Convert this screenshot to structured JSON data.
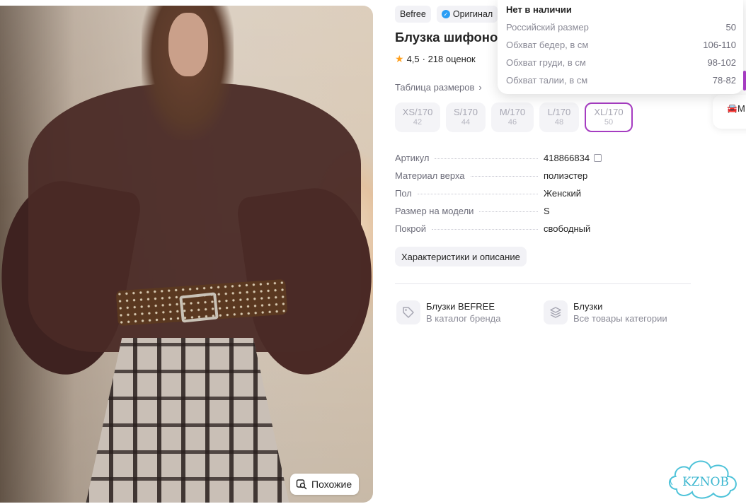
{
  "photo": {
    "alt_label": "",
    "similar_button": "Похожие"
  },
  "badges": {
    "brand": "Befree",
    "original": "Оригинал"
  },
  "product": {
    "title": "Блузка шифоно",
    "rating": "4,5",
    "reviews": "· 218 оценок",
    "size_table_link": "Таблица размеров"
  },
  "sizes": [
    {
      "label": "XS/170",
      "ru": "42",
      "selected": false
    },
    {
      "label": "S/170",
      "ru": "44",
      "selected": false
    },
    {
      "label": "M/170",
      "ru": "46",
      "selected": false
    },
    {
      "label": "L/170",
      "ru": "48",
      "selected": false
    },
    {
      "label": "XL/170",
      "ru": "50",
      "selected": true
    }
  ],
  "specs": [
    {
      "key": "Артикул",
      "value": "418866834"
    },
    {
      "key": "Материал верха",
      "value": "полиэстер"
    },
    {
      "key": "Пол",
      "value": "Женский"
    },
    {
      "key": "Размер на модели",
      "value": "S"
    },
    {
      "key": "Покрой",
      "value": "свободный"
    }
  ],
  "chars_button": "Характеристики и описание",
  "categories": [
    {
      "title": "Блузки BEFREE",
      "sub": "В каталог бренда",
      "icon": "tag-icon"
    },
    {
      "title": "Блузки",
      "sub": "Все товары категории",
      "icon": "layers-icon"
    }
  ],
  "tooltip": {
    "head": "Нет в наличии",
    "rows": [
      {
        "k": "Российский размер",
        "v": "50"
      },
      {
        "k": "Обхват бедер, в см",
        "v": "106-110"
      },
      {
        "k": "Обхват груди, в см",
        "v": "98-102"
      },
      {
        "k": "Обхват талии, в см",
        "v": "78-82"
      }
    ]
  },
  "side_card": {
    "label": "М"
  },
  "watermark": "KZNOB",
  "colors": {
    "accent": "#a53cc1",
    "star": "#ff9f1c",
    "verified": "#2a9df4"
  }
}
